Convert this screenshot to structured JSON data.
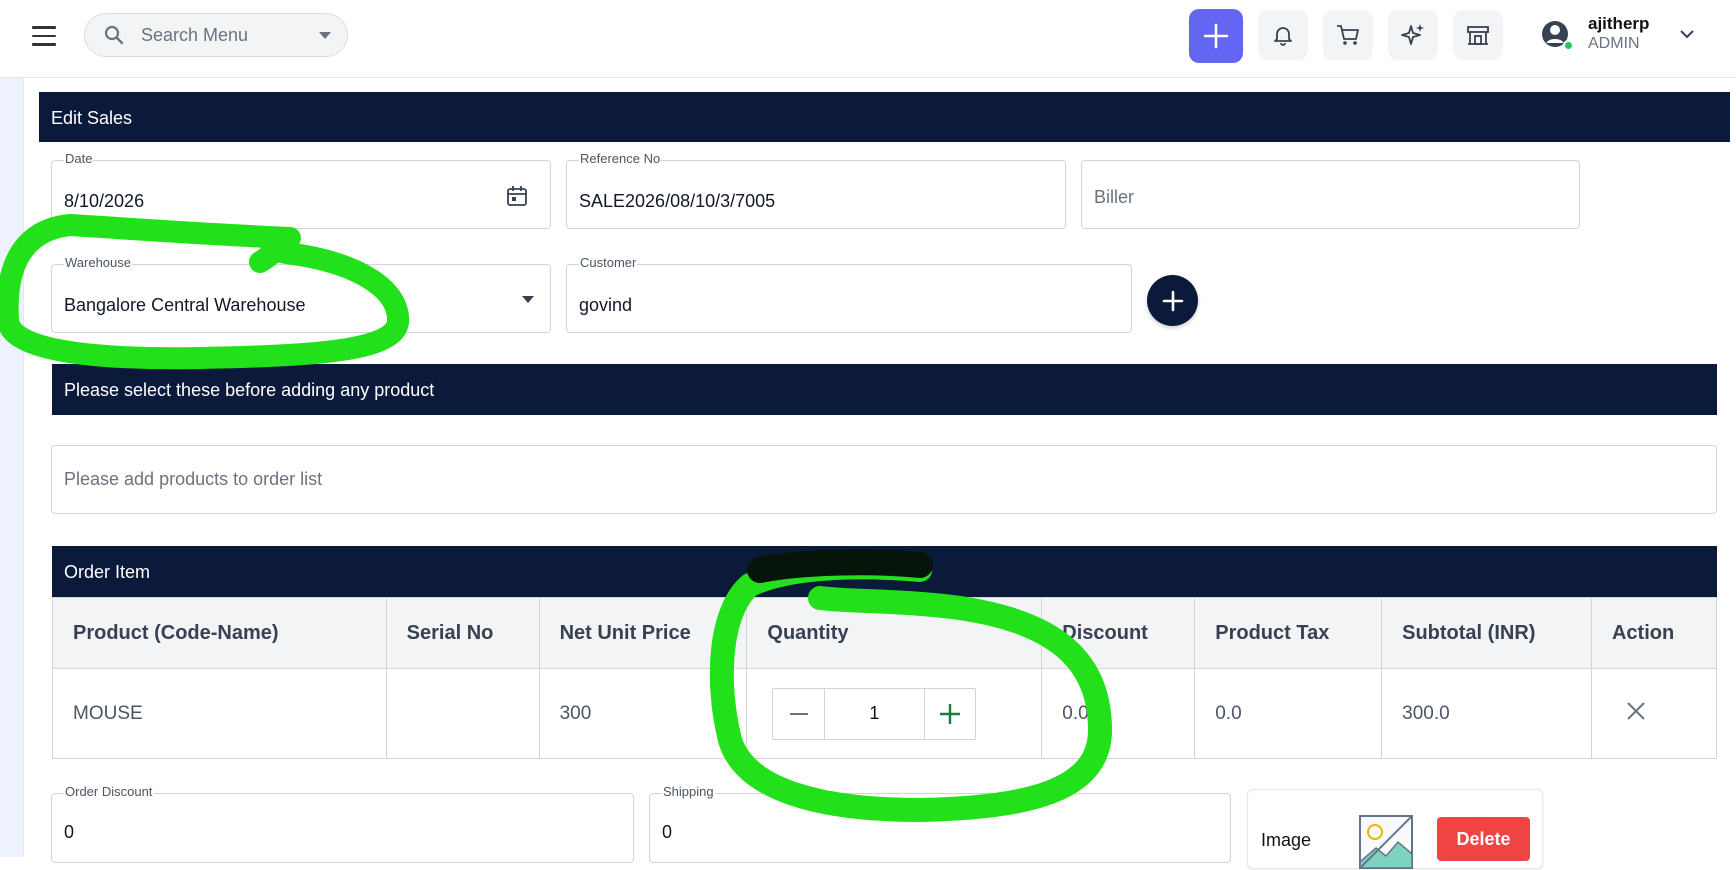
{
  "topbar": {
    "search_placeholder": "Search Menu",
    "user_name": "ajitherp",
    "user_role": "ADMIN"
  },
  "form": {
    "title": "Edit Sales",
    "date_label": "Date",
    "date_value": "8/10/2026",
    "reference_label": "Reference No",
    "reference_value": "SALE2026/08/10/3/7005",
    "biller_placeholder": "Biller",
    "warehouse_label": "Warehouse",
    "warehouse_value": "Bangalore Central Warehouse",
    "customer_label": "Customer",
    "customer_value": "govind",
    "notice": "Please select these before adding any product",
    "product_search_placeholder": "Please add products to order list"
  },
  "order": {
    "title": "Order Item",
    "columns": [
      "Product (Code-Name)",
      "Serial No",
      "Net Unit Price",
      "Quantity",
      "Discount",
      "Product Tax",
      "Subtotal (INR)",
      "Action"
    ],
    "rows": [
      {
        "product": "MOUSE",
        "serial": "",
        "net_unit_price": "300",
        "quantity": "1",
        "discount": "0.0",
        "tax": "0.0",
        "subtotal": "300.0"
      }
    ]
  },
  "footer": {
    "order_discount_label": "Order Discount",
    "order_discount_value": "0",
    "shipping_label": "Shipping",
    "shipping_value": "0",
    "image_label": "Image",
    "delete_label": "Delete"
  },
  "colors": {
    "header_navy": "#0b1a3a",
    "accent_purple": "#6366f1",
    "delete_red": "#ef4444",
    "annotation_green": "#22e01a"
  }
}
